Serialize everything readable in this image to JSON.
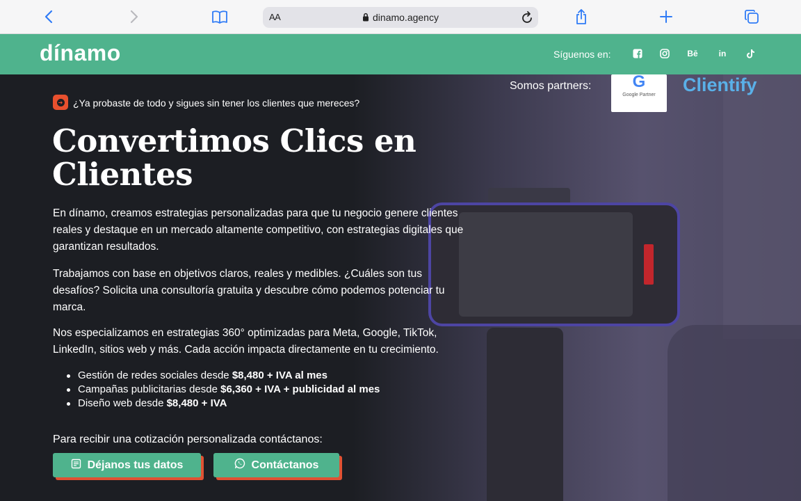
{
  "browser": {
    "text_size_label": "AA",
    "url": "dinamo.agency"
  },
  "header": {
    "logo": "dínamo",
    "social_label": "Síguenos en:",
    "social_icons": [
      "facebook-icon",
      "instagram-icon",
      "behance-icon",
      "linkedin-icon",
      "tiktok-icon"
    ],
    "behance_text": "Bē",
    "linkedin_text": "in"
  },
  "partners": {
    "label": "Somos partners:",
    "google_letter": "G",
    "google_text": "Google Partner",
    "clientify": "Clientify"
  },
  "hero": {
    "tagline": "¿Ya probaste de todo y sigues sin tener los clientes que mereces?",
    "headline": "Convertimos Clics en Clientes",
    "p1": "En dínamo, creamos estrategias personalizadas para que tu negocio genere clientes reales y destaque en un mercado altamente competitivo, con estrategias digitales que garantizan resultados.",
    "p2": "Trabajamos con base en objetivos claros, reales y medibles. ¿Cuáles son tus desafíos? Solicita una consultoría gratuita y descubre cómo podemos potenciar tu marca.",
    "p3": "Nos especializamos en estrategias 360° optimizadas para Meta, Google, TikTok, LinkedIn, sitios web y más. Cada acción impacta directamente en tu crecimiento.",
    "bullets": [
      {
        "text": "Gestión de redes sociales desde ",
        "bold": "$8,480 + IVA al mes"
      },
      {
        "text": "Campañas publicitarias desde ",
        "bold": "$6,360 + IVA + publicidad al mes"
      },
      {
        "text": "Diseño web desde ",
        "bold": "$8,480 + IVA"
      }
    ],
    "cta_label": "Para recibir una cotización personalizada contáctanos:",
    "button_data": "Déjanos tus datos",
    "button_contact": "Contáctanos"
  },
  "colors": {
    "brand_green": "#4fb38d",
    "accent_orange": "#e05233",
    "browser_blue": "#2f7bf6"
  }
}
